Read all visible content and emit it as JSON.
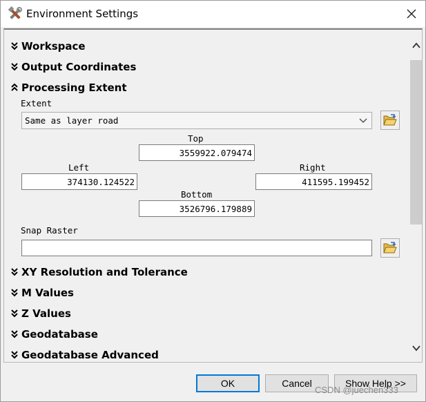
{
  "window": {
    "title": "Environment Settings"
  },
  "title_icon": "tools-icon",
  "close_icon": "close-icon",
  "sections": [
    {
      "label": "Workspace",
      "state": "collapsed"
    },
    {
      "label": "Output Coordinates",
      "state": "collapsed"
    },
    {
      "label": "Processing Extent",
      "state": "expanded"
    },
    {
      "label": "XY Resolution and Tolerance",
      "state": "collapsed"
    },
    {
      "label": "M Values",
      "state": "collapsed"
    },
    {
      "label": "Z Values",
      "state": "collapsed"
    },
    {
      "label": "Geodatabase",
      "state": "collapsed"
    },
    {
      "label": "Geodatabase Advanced",
      "state": "collapsed"
    }
  ],
  "extent": {
    "label": "Extent",
    "selected": "Same as layer road",
    "top_label": "Top",
    "top": "3559922.079474",
    "left_label": "Left",
    "left": "374130.124522",
    "right_label": "Right",
    "right": "411595.199452",
    "bottom_label": "Bottom",
    "bottom": "3526796.179889"
  },
  "snap": {
    "label": "Snap Raster",
    "value": ""
  },
  "buttons": {
    "ok": "OK",
    "cancel": "Cancel",
    "help": "Show Help >>"
  },
  "watermark": "CSDN @juechen333",
  "colors": {
    "ok_focus": "#0078d7",
    "scroll_thumb": "#cdcdcd"
  }
}
